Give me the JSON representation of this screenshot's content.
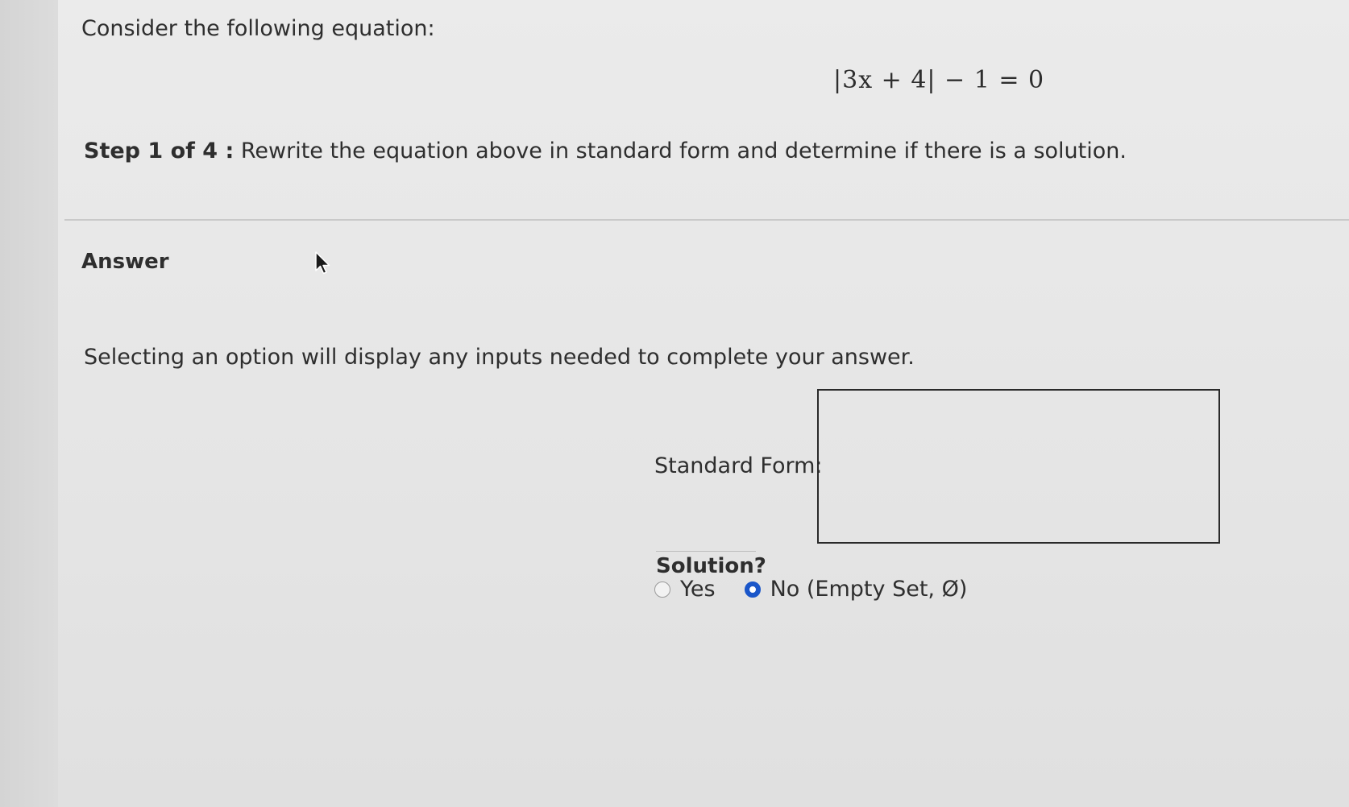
{
  "question": {
    "intro": "Consider the following equation:",
    "equation": "|3x + 4| − 1 = 0",
    "step_label": "Step 1 of 4 :",
    "step_text": "Rewrite the equation above in standard form and determine if there is a solution."
  },
  "answer": {
    "heading": "Answer",
    "instructions": "Selecting an option will display any inputs needed to complete your answer.",
    "standard_form_label": "Standard Form:",
    "standard_form_value": "",
    "solution_heading": "Solution?",
    "options": [
      {
        "label": "Yes",
        "selected": false
      },
      {
        "label": "No (Empty Set, Ø)",
        "selected": true
      }
    ]
  },
  "colors": {
    "accent": "#1a56c9",
    "text": "#2e2e2e",
    "background": "#e8e8e8"
  },
  "icons": {
    "cursor": "mouse-pointer-icon"
  }
}
